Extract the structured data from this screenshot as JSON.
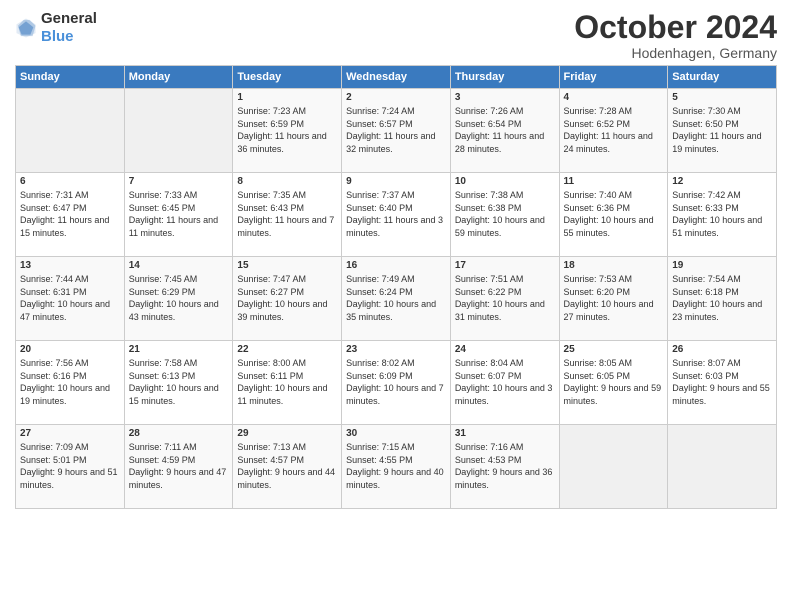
{
  "logo": {
    "text_general": "General",
    "text_blue": "Blue"
  },
  "header": {
    "month": "October 2024",
    "location": "Hodenhagen, Germany"
  },
  "weekdays": [
    "Sunday",
    "Monday",
    "Tuesday",
    "Wednesday",
    "Thursday",
    "Friday",
    "Saturday"
  ],
  "weeks": [
    [
      {
        "day": "",
        "empty": true
      },
      {
        "day": "",
        "empty": true
      },
      {
        "day": "1",
        "sunrise": "7:23 AM",
        "sunset": "6:59 PM",
        "daylight": "11 hours and 36 minutes."
      },
      {
        "day": "2",
        "sunrise": "7:24 AM",
        "sunset": "6:57 PM",
        "daylight": "11 hours and 32 minutes."
      },
      {
        "day": "3",
        "sunrise": "7:26 AM",
        "sunset": "6:54 PM",
        "daylight": "11 hours and 28 minutes."
      },
      {
        "day": "4",
        "sunrise": "7:28 AM",
        "sunset": "6:52 PM",
        "daylight": "11 hours and 24 minutes."
      },
      {
        "day": "5",
        "sunrise": "7:30 AM",
        "sunset": "6:50 PM",
        "daylight": "11 hours and 19 minutes."
      }
    ],
    [
      {
        "day": "6",
        "sunrise": "7:31 AM",
        "sunset": "6:47 PM",
        "daylight": "11 hours and 15 minutes."
      },
      {
        "day": "7",
        "sunrise": "7:33 AM",
        "sunset": "6:45 PM",
        "daylight": "11 hours and 11 minutes."
      },
      {
        "day": "8",
        "sunrise": "7:35 AM",
        "sunset": "6:43 PM",
        "daylight": "11 hours and 7 minutes."
      },
      {
        "day": "9",
        "sunrise": "7:37 AM",
        "sunset": "6:40 PM",
        "daylight": "11 hours and 3 minutes."
      },
      {
        "day": "10",
        "sunrise": "7:38 AM",
        "sunset": "6:38 PM",
        "daylight": "10 hours and 59 minutes."
      },
      {
        "day": "11",
        "sunrise": "7:40 AM",
        "sunset": "6:36 PM",
        "daylight": "10 hours and 55 minutes."
      },
      {
        "day": "12",
        "sunrise": "7:42 AM",
        "sunset": "6:33 PM",
        "daylight": "10 hours and 51 minutes."
      }
    ],
    [
      {
        "day": "13",
        "sunrise": "7:44 AM",
        "sunset": "6:31 PM",
        "daylight": "10 hours and 47 minutes."
      },
      {
        "day": "14",
        "sunrise": "7:45 AM",
        "sunset": "6:29 PM",
        "daylight": "10 hours and 43 minutes."
      },
      {
        "day": "15",
        "sunrise": "7:47 AM",
        "sunset": "6:27 PM",
        "daylight": "10 hours and 39 minutes."
      },
      {
        "day": "16",
        "sunrise": "7:49 AM",
        "sunset": "6:24 PM",
        "daylight": "10 hours and 35 minutes."
      },
      {
        "day": "17",
        "sunrise": "7:51 AM",
        "sunset": "6:22 PM",
        "daylight": "10 hours and 31 minutes."
      },
      {
        "day": "18",
        "sunrise": "7:53 AM",
        "sunset": "6:20 PM",
        "daylight": "10 hours and 27 minutes."
      },
      {
        "day": "19",
        "sunrise": "7:54 AM",
        "sunset": "6:18 PM",
        "daylight": "10 hours and 23 minutes."
      }
    ],
    [
      {
        "day": "20",
        "sunrise": "7:56 AM",
        "sunset": "6:16 PM",
        "daylight": "10 hours and 19 minutes."
      },
      {
        "day": "21",
        "sunrise": "7:58 AM",
        "sunset": "6:13 PM",
        "daylight": "10 hours and 15 minutes."
      },
      {
        "day": "22",
        "sunrise": "8:00 AM",
        "sunset": "6:11 PM",
        "daylight": "10 hours and 11 minutes."
      },
      {
        "day": "23",
        "sunrise": "8:02 AM",
        "sunset": "6:09 PM",
        "daylight": "10 hours and 7 minutes."
      },
      {
        "day": "24",
        "sunrise": "8:04 AM",
        "sunset": "6:07 PM",
        "daylight": "10 hours and 3 minutes."
      },
      {
        "day": "25",
        "sunrise": "8:05 AM",
        "sunset": "6:05 PM",
        "daylight": "9 hours and 59 minutes."
      },
      {
        "day": "26",
        "sunrise": "8:07 AM",
        "sunset": "6:03 PM",
        "daylight": "9 hours and 55 minutes."
      }
    ],
    [
      {
        "day": "27",
        "sunrise": "7:09 AM",
        "sunset": "5:01 PM",
        "daylight": "9 hours and 51 minutes."
      },
      {
        "day": "28",
        "sunrise": "7:11 AM",
        "sunset": "4:59 PM",
        "daylight": "9 hours and 47 minutes."
      },
      {
        "day": "29",
        "sunrise": "7:13 AM",
        "sunset": "4:57 PM",
        "daylight": "9 hours and 44 minutes."
      },
      {
        "day": "30",
        "sunrise": "7:15 AM",
        "sunset": "4:55 PM",
        "daylight": "9 hours and 40 minutes."
      },
      {
        "day": "31",
        "sunrise": "7:16 AM",
        "sunset": "4:53 PM",
        "daylight": "9 hours and 36 minutes."
      },
      {
        "day": "",
        "empty": true
      },
      {
        "day": "",
        "empty": true
      }
    ]
  ]
}
